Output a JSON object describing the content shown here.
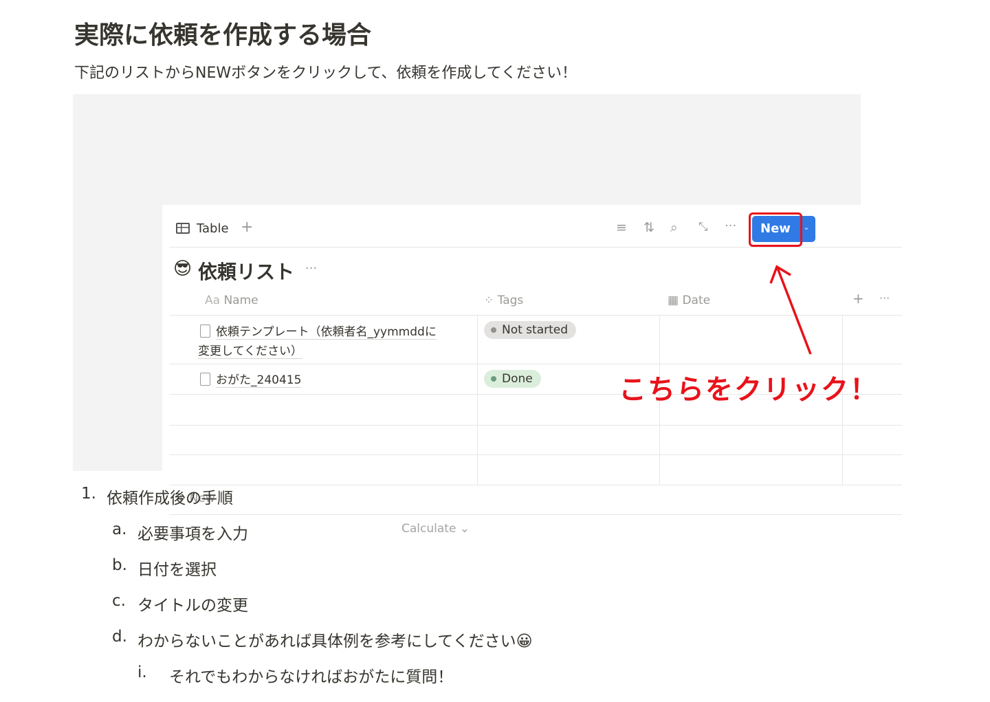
{
  "heading": "実際に依頼を作成する場合",
  "intro": "下記のリストからNEWボタンをクリックして、依頼を作成してください！",
  "screenshot": {
    "view_tab": "Table",
    "toolbar_icons": [
      "filter-icon",
      "sort-icon",
      "search-icon",
      "expand-icon",
      "more-icon"
    ],
    "new_button": "New",
    "db_title": "依頼リスト",
    "db_emoji": "😎",
    "columns": {
      "name": "Name",
      "name_prefix": "Aa",
      "tags": "Tags",
      "date": "Date"
    },
    "rows": [
      {
        "name_line1": "依頼テンプレート（依頼者名_yymmddに",
        "name_line2": "変更してください）",
        "tag": "Not started",
        "tag_bg": "#e3e2e0",
        "tag_dot": "#91918e"
      },
      {
        "name_line1": "おがた_240415",
        "tag": "Done",
        "tag_bg": "#dbeddb",
        "tag_dot": "#6c9b7d"
      }
    ],
    "add_row": "New",
    "calculate": "Calculate",
    "annotation": "こちらをクリック！",
    "annotation_color": "#e8121a"
  },
  "steps": {
    "main": {
      "num": "1.",
      "text": "依頼作成後の手順"
    },
    "sub": [
      {
        "num": "a.",
        "text": "必要事項を入力"
      },
      {
        "num": "b.",
        "text": "日付を選択"
      },
      {
        "num": "c.",
        "text": "タイトルの変更"
      },
      {
        "num": "d.",
        "text": "わからないことがあれば具体例を参考にしてください😀"
      }
    ],
    "subsub": {
      "num": "i.",
      "text": "それでもわからなければおがたに質問！"
    }
  }
}
